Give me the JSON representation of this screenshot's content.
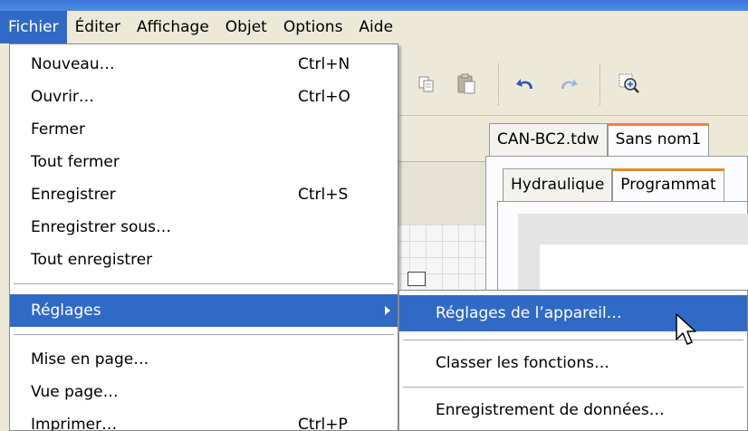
{
  "menubar": {
    "items": [
      {
        "label": "Fichier",
        "active": true
      },
      {
        "label": "Éditer"
      },
      {
        "label": "Affichage"
      },
      {
        "label": "Objet"
      },
      {
        "label": "Options"
      },
      {
        "label": "Aide"
      }
    ]
  },
  "file_menu": {
    "items": [
      {
        "label": "Nouveau…",
        "shortcut": "Ctrl+N"
      },
      {
        "label": "Ouvrir…",
        "shortcut": "Ctrl+O"
      },
      {
        "label": "Fermer"
      },
      {
        "label": "Tout fermer"
      },
      {
        "label": "Enregistrer",
        "shortcut": "Ctrl+S"
      },
      {
        "label": "Enregistrer sous…"
      },
      {
        "label": "Tout enregistrer"
      },
      {
        "label": "Réglages",
        "highlighted": true,
        "has_submenu": true
      },
      {
        "label": "Mise en page…"
      },
      {
        "label": "Vue page…"
      },
      {
        "label": "Imprimer…",
        "shortcut": "Ctrl+P"
      }
    ]
  },
  "submenu": {
    "items": [
      {
        "label": "Réglages de l’appareil…",
        "highlighted": true
      },
      {
        "label": "Classer les fonctions…"
      },
      {
        "label": "Enregistrement de données…"
      }
    ]
  },
  "document_tabs": [
    {
      "label": "CAN-BC2.tdw"
    },
    {
      "label": "Sans nom1",
      "selected": true
    }
  ],
  "view_tabs": [
    {
      "label": "Hydraulique"
    },
    {
      "label": "Programmat",
      "selected": true
    }
  ],
  "toolbar": {
    "icons": [
      "copy-icon",
      "paste-icon",
      "undo-icon",
      "redo-icon",
      "zoom-icon"
    ]
  },
  "colors": {
    "highlight": "#316ac5",
    "menubar_bg": "#ece9d8",
    "tab_accent": "#e68b2c"
  }
}
